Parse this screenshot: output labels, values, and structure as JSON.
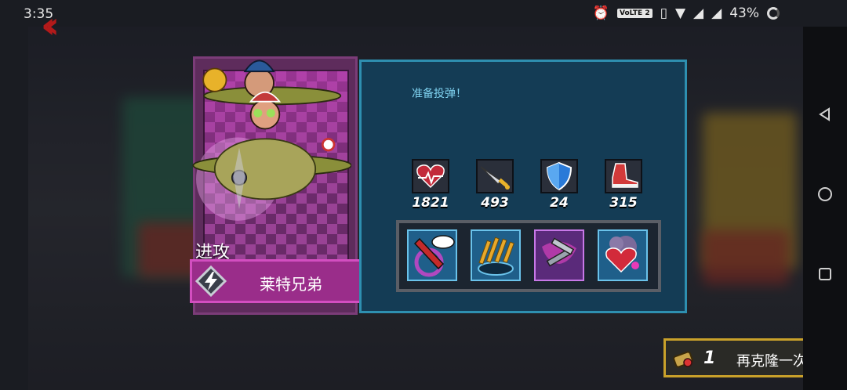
{
  "status_bar": {
    "time": "3:35",
    "network_badge": "VoLTE 2",
    "battery": "43%"
  },
  "hero": {
    "class_label": "进攻",
    "name": "莱特兄弟"
  },
  "panel": {
    "description": "准备投弹！",
    "stats": [
      {
        "icon": "heart-icon",
        "value": "1821"
      },
      {
        "icon": "sword-icon",
        "value": "493"
      },
      {
        "icon": "shield-icon",
        "value": "24"
      },
      {
        "icon": "boot-icon",
        "value": "315"
      }
    ],
    "skills": [
      {
        "icon": "rocket-boom-icon"
      },
      {
        "icon": "bullet-rain-icon"
      },
      {
        "icon": "wrench-repair-icon"
      },
      {
        "icon": "explosion-heart-icon"
      }
    ]
  },
  "clone_button": {
    "count": "1",
    "label": "再克隆一次"
  },
  "colors": {
    "card": "#9a2d8a",
    "panel": "#143c55",
    "panel_border": "#2e8fb0",
    "accent_gold": "#c9a12a"
  }
}
